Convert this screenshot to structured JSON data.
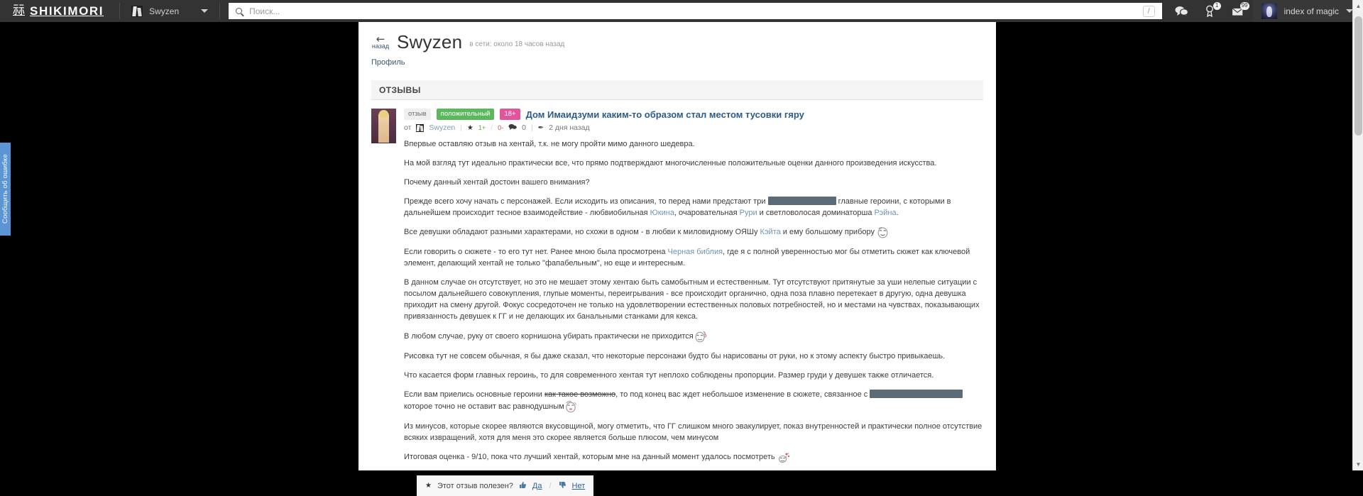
{
  "topbar": {
    "brand": "SHIKIMORI",
    "brand_glyph": "祘",
    "user_menu_name": "Swyzen",
    "search_placeholder": "Поиск...",
    "search_value": "",
    "search_hotkey": "/",
    "icons": {
      "chat": "chat-icon",
      "notifications": "notifications-icon",
      "notifications_badge": "1",
      "messages": "messages-icon",
      "messages_badge": "99"
    },
    "account_name": "index of magic"
  },
  "feedback_tab": {
    "label": "Сообщить об ошибке"
  },
  "profile": {
    "back_label": "назад",
    "back_arrow": "←",
    "name": "Swyzen",
    "online_status": "в сети: около 18 часов назад",
    "tab_label": "Профиль"
  },
  "section": {
    "title": "ОТЗЫВЫ"
  },
  "review": {
    "tag_type": "отзыв",
    "tag_opinion": "положительный",
    "tag_age": "18+",
    "title": "Дом Имаидзуми каким-то образом стал местом тусовки гяру",
    "meta": {
      "by_label": "от",
      "author": "Swyzen",
      "star": "★",
      "votes_up": "1+",
      "votes_slash": "/",
      "votes_down": "0-",
      "comments_icon": "💬",
      "comments_count": "0",
      "edit_icon": "✒",
      "date": "2 дня назад"
    },
    "paragraphs": {
      "p1": "Впервые оставляю отзыв на хентай, т.к. не могу пройти мимо данного шедевра.",
      "p2": "На мой взгляд тут идеально практически все, что прямо подтверждают многочисленные положительные оценки данного произведения искусства.",
      "p3": "Почему данный хентай достоин вашего внимания?",
      "p4_a": "Прежде всего хочу начать с персонажей. Если исходить из описания, то перед нами предстают три ",
      "p4_b": " главные героини, с которыми в дальнейшем происходит тесное взаимодействие - любвиобильная ",
      "p4_c": ", очаровательная ",
      "p4_d": " и светловолосая доминаторша ",
      "p4_e": ".",
      "char1": "Юкина",
      "char2": "Рури",
      "char3": "Рэйна",
      "p5_a": "Все девушки обладают разными характерами, но схожи в одном - в любви к миловидному ОЯШу ",
      "char4": "Кэйта",
      "p5_b": " и ему большому прибору ",
      "p6_a": "Если говорить о сюжете - то его тут нет. Ранее мною была просмотрена ",
      "link_black_bible": "Черная библия",
      "p6_b": ", где я с полной уверенностью мог бы отметить сюжет как ключевой элемент, делающий хентай не только \"фапабельным\", но еще и интересным.",
      "p7": "В данном случае он отсутствует, но это не мешает этому хентаю быть самобытным и естественным. Тут отсутствуют притянутые за уши нелепые ситуации с посылом дальнейшего совокупления, глупые моменты, переигрывания - все происходит органично, одна поза плавно перетекает в другую, одна девушка приходит на смену другой. Фокус сосредоточен не только на удовлетворении естественных половых потребностей, но и местами на чувствах, показывающих привязанность девушек к ГГ и не делающих их банальными станками для кекса.",
      "p8": "В любом случае, руку от своего корнишона убирать практически не приходится",
      "p9": "Рисовка тут не совсем обычная, я бы даже сказал, что некоторые персонажи будто бы нарисованы от руки, но к этому аспекту быстро привыкаешь.",
      "p10": "Что касается форм главных героинь, то для современного хентая тут неплохо соблюдены пропорции. Размер груди у девушек также отличается.",
      "p11_a": "Если вам приелись основные героини ",
      "p11_strike": "как такое возможно",
      "p11_b": ", то под конец вас ждет небольшое изменение в сюжете, связанное с ",
      "p11_c": " которое точно не оставит вас равнодушным",
      "p12": "Из минусов, которые скорее являются вкусовщиной, могу отметить, что ГГ слишком много эвакулирует, показ внутренностей и практически полное отсутствие всяких извращений, хотя для меня это скорее является больше плюсом, чем минусом",
      "p13": "Итоговая оценка - 9/10, пока что лучший хентай, которым мне на данный момент удалось посмотреть"
    },
    "helpful": {
      "star": "★",
      "question": "Этот отзыв полезен?",
      "yes": "Да",
      "sep": "/",
      "no": "Нет"
    }
  },
  "colors": {
    "topbar_bg": "#333333",
    "accent_link": "#2d5b87",
    "positive": "#5cb85c",
    "age": "#e0559c",
    "spoiler": "#5b6b78",
    "feedback_tab": "#5b95d6"
  }
}
